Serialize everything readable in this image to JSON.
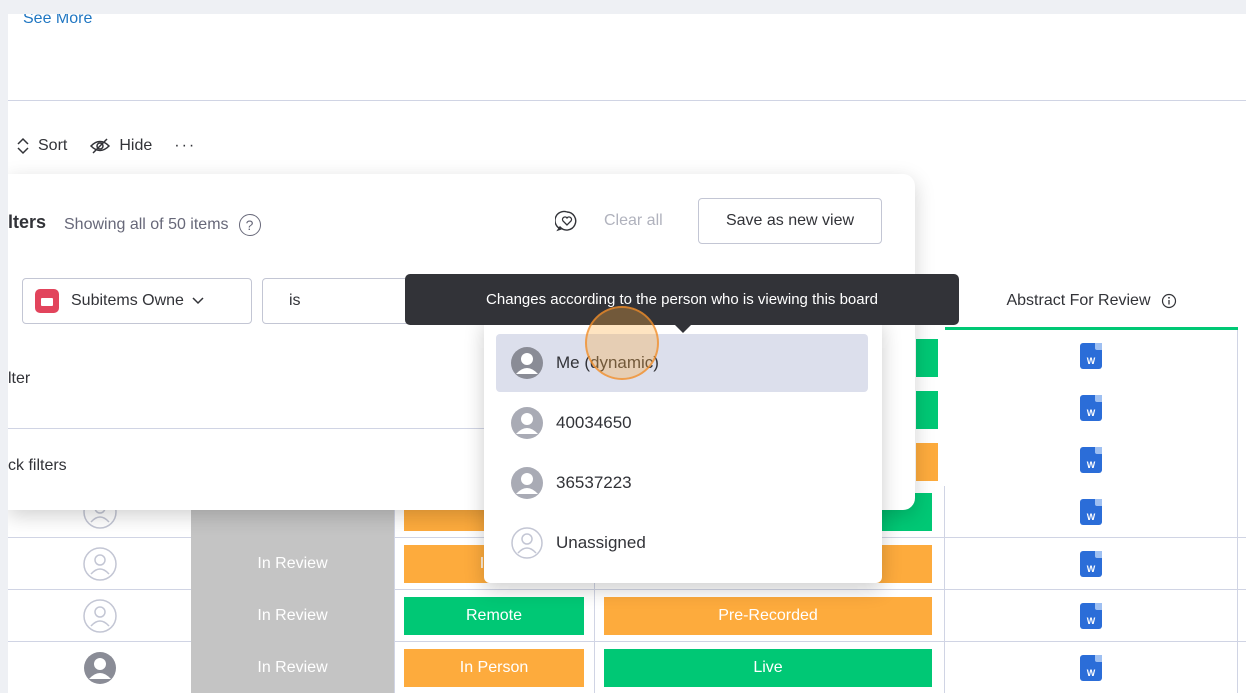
{
  "header": {
    "see_more": "See More"
  },
  "toolbar": {
    "sort_label": "Sort",
    "hide_label": "Hide",
    "more_label": "···"
  },
  "filters": {
    "title": "lters",
    "subtitle": "Showing all of 50 items",
    "help": "?",
    "clear_all": "Clear all",
    "save_view": "Save as new view",
    "column_value": "Subitems Owne",
    "condition_value": "is",
    "add_filter": "lter",
    "quick_filters": "ck filters"
  },
  "tooltip": {
    "text": "Changes according to the person who is viewing this board"
  },
  "dropdown": {
    "options": [
      {
        "label": "Me (dynamic)",
        "selected": true,
        "icon": "person-icon"
      },
      {
        "label": "40034650",
        "selected": false,
        "icon": "person-icon"
      },
      {
        "label": "36537223",
        "selected": false,
        "icon": "person-icon"
      },
      {
        "label": "Unassigned",
        "selected": false,
        "icon": "person-outline-icon"
      }
    ]
  },
  "table": {
    "abstract_header": "Abstract For Review",
    "rows": [
      {
        "status": "In Review",
        "mode": "In P",
        "mode_color": "#fdab3d",
        "rec": "",
        "rec_color": "#fdab3d"
      },
      {
        "status": "In Review",
        "mode": "In P",
        "mode_color": "#fdab3d",
        "rec": "",
        "rec_color": "#fdab3d"
      },
      {
        "status": "In Review",
        "mode": "Remote",
        "mode_color": "#00c875",
        "rec": "Pre-Recorded",
        "rec_color": "#fdab3d"
      },
      {
        "status": "In Review",
        "mode": "In Person",
        "mode_color": "#fdab3d",
        "rec": "Live",
        "rec_color": "#00c875"
      }
    ],
    "doc_icon_label": "W"
  },
  "colors": {
    "accent_blue": "#1f76c2",
    "status_grey": "#c4c4c4",
    "orange": "#fdab3d",
    "green": "#00c875",
    "tooltip_bg": "#323338"
  }
}
